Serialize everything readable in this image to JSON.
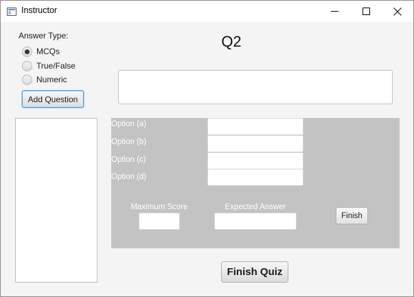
{
  "window": {
    "title": "Instructor",
    "icon": "java-app-icon",
    "controls": [
      "minimize-icon",
      "maximize-icon",
      "close-icon"
    ]
  },
  "sidebar": {
    "answer_type_label": "Answer Type:",
    "answer_types": [
      {
        "label": "MCQs",
        "selected": true
      },
      {
        "label": "True/False",
        "selected": false
      },
      {
        "label": "Numeric",
        "selected": false
      }
    ],
    "add_question_label": "Add Question",
    "question_list": []
  },
  "main": {
    "question_heading": "Q2",
    "question_text": "",
    "options": [
      {
        "label": "Option (a)",
        "value": ""
      },
      {
        "label": "Option (b)",
        "value": ""
      },
      {
        "label": "Option (c)",
        "value": ""
      },
      {
        "label": "Option (d)",
        "value": ""
      }
    ],
    "max_score_label": "Maximum Score",
    "max_score_value": "",
    "expected_answer_label": "Expected Answer",
    "expected_answer_value": "",
    "finish_label": "Finish",
    "finish_quiz_label": "Finish Quiz"
  },
  "colors": {
    "panel_gray": "#c3c3c3",
    "focus_blue": "#3e9ee0",
    "window_bg": "#f4f4f4"
  }
}
